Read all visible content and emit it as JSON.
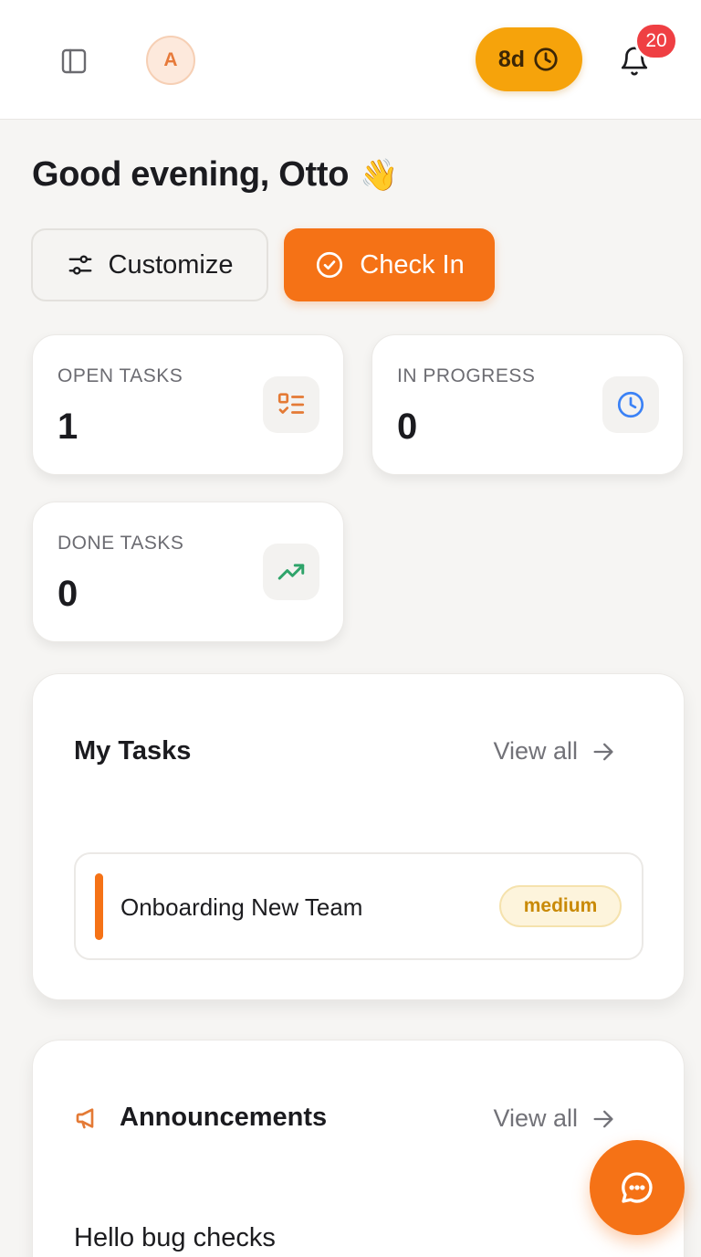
{
  "topbar": {
    "avatar_initial": "A",
    "streak_label": "8d",
    "notification_count": "20"
  },
  "greeting": {
    "text": "Good evening, Otto",
    "emoji": "👋"
  },
  "actions": {
    "customize_label": "Customize",
    "checkin_label": "Check In"
  },
  "stats": [
    {
      "label": "OPEN TASKS",
      "value": "1",
      "icon": "checklist-icon",
      "color": "#e47a35"
    },
    {
      "label": "IN PROGRESS",
      "value": "0",
      "icon": "clock-icon",
      "color": "#3b82f6"
    },
    {
      "label": "DONE TASKS",
      "value": "0",
      "icon": "trending-up-icon",
      "color": "#2fa46a"
    }
  ],
  "my_tasks": {
    "title": "My Tasks",
    "view_all_label": "View all",
    "items": [
      {
        "title": "Onboarding New Team",
        "priority": "medium"
      }
    ]
  },
  "announcements": {
    "title": "Announcements",
    "view_all_label": "View all",
    "items": [
      {
        "title": "Hello bug checks"
      }
    ]
  },
  "colors": {
    "accent": "#f57216",
    "streak": "#f6a30b",
    "notification_badge": "#ef3f43",
    "background": "#f6f5f3"
  }
}
